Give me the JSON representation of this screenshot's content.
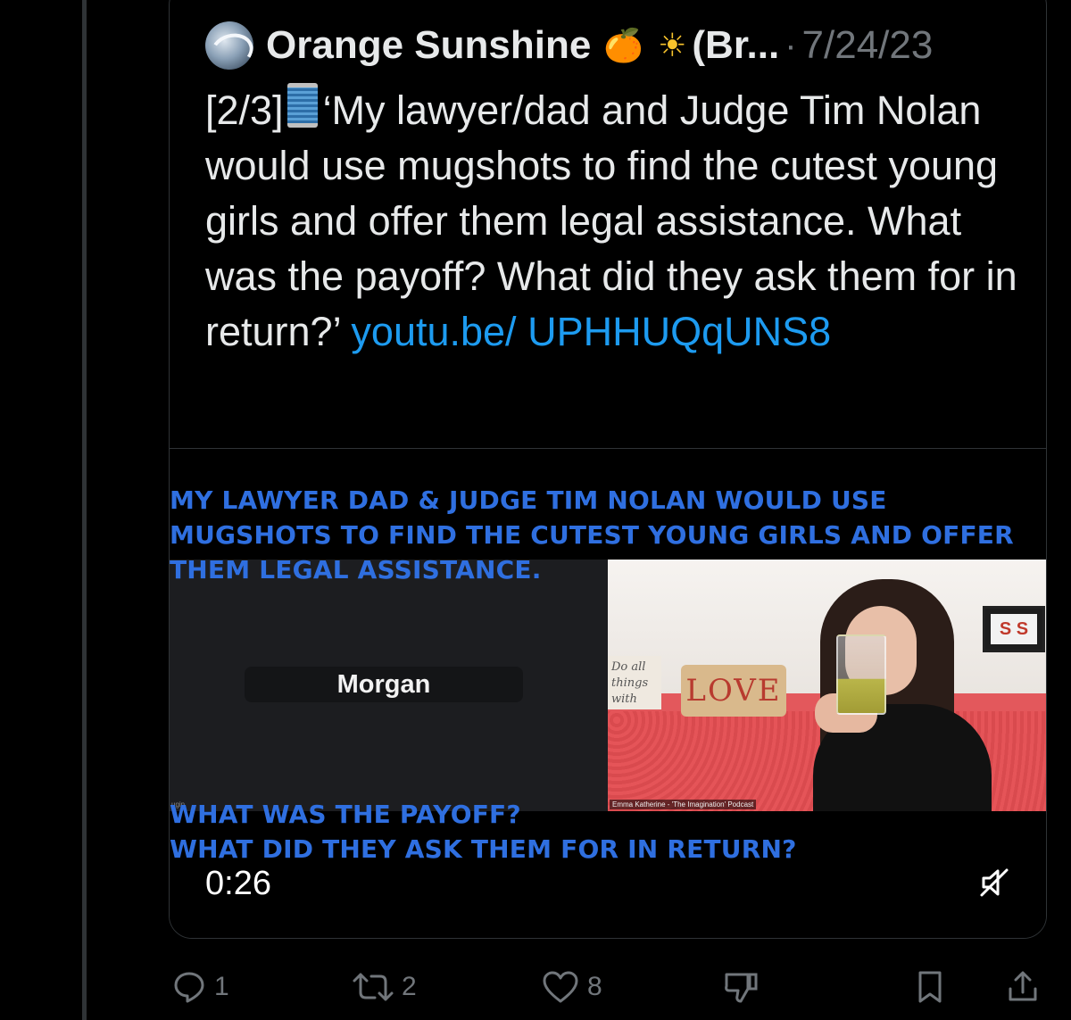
{
  "tweet": {
    "author_name": "Orange Sunshine",
    "author_emoji_1": "🍊",
    "author_emoji_2": "☀",
    "author_name_suffix": "(Br...",
    "separator": "·",
    "date": "7/24/23",
    "text_prefix": "[2/3]",
    "text_body": "‘My lawyer/dad and Judge Tim Nolan would use mugshots to find the cutest young girls and offer them legal assistance. What was the payoff? What did they ask them for in return?’ ",
    "link_text": "youtu.be/ UPHHUQqUNS8"
  },
  "video": {
    "caption_top_lines": [
      "MY LAWYER DAD & JUDGE TIM NOLAN WOULD USE",
      "MUGSHOTS TO FIND THE CUTEST YOUNG GIRLS AND OFFER",
      "THEM LEGAL ASSISTANCE."
    ],
    "caption_bottom_lines": [
      "WHAT WAS THE PAYOFF?",
      "WHAT DID THEY ASK THEM FOR IN RETURN?"
    ],
    "participant_name": "Morgan",
    "left_tiny_label": "ugin",
    "sign_text": "Do all things with",
    "pillow_text": "LOVE",
    "frame_text": "S S",
    "speaker_credit": "Emma Katherine - 'The Imagination' Podcast",
    "timestamp": "0:26",
    "mute_icon": "speaker-muted-icon"
  },
  "actions": {
    "reply_count": "1",
    "repost_count": "2",
    "like_count": "8"
  },
  "colors": {
    "background": "#000000",
    "text": "#e7e9ea",
    "muted": "#71767b",
    "link": "#1d9bf0",
    "caption_blue": "#2f6fe0",
    "border": "#2f3336"
  }
}
